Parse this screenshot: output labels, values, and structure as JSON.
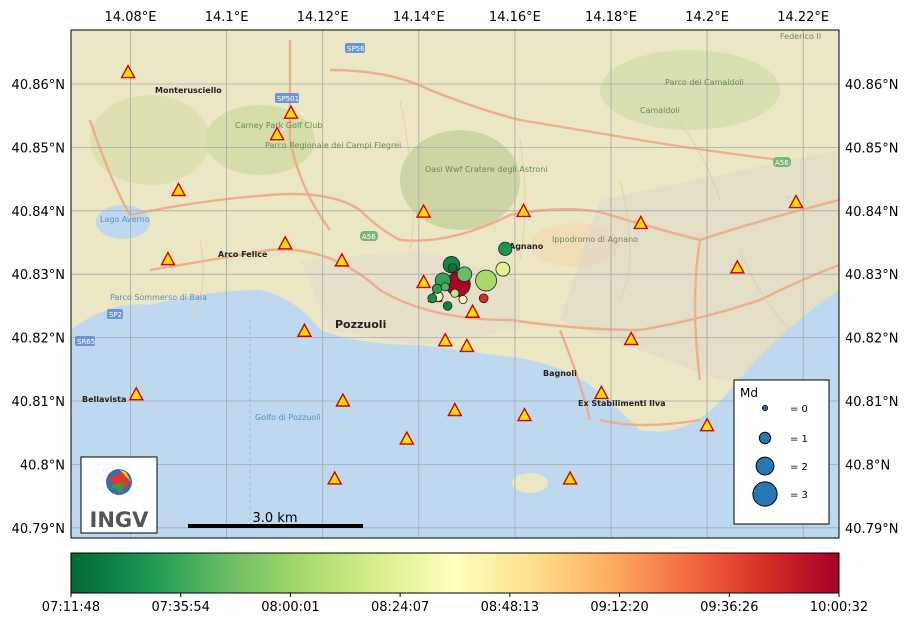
{
  "map": {
    "lon_ticks": [
      "14.08°E",
      "14.1°E",
      "14.12°E",
      "14.14°E",
      "14.16°E",
      "14.18°E",
      "14.2°E",
      "14.22°E"
    ],
    "lat_ticks": [
      "40.86°N",
      "40.85°N",
      "40.84°N",
      "40.83°N",
      "40.82°N",
      "40.81°N",
      "40.8°N",
      "40.79°N"
    ],
    "place_labels": {
      "monterusciello": "Monterusciello",
      "arco_felice": "Arco Felice",
      "pozzuoli": "Pozzuoli",
      "agnano": "Agnano",
      "bagnoli": "Bagnoli",
      "bellavista": "Bellavista",
      "lago_averno": "Lago Averno",
      "golfo": "Golfo di Pozzuoli",
      "carney": "Carney Park Golf Club",
      "campi_flegrei_park": "Parco Regionale dei Campi Flegrei",
      "astroni": "Oasi Wwf Cratere degli Astroni",
      "ippodromo": "Ippodromo di Agnano",
      "camaldoli": "Camaldoli",
      "parco_baia": "Parco Sommerso di Baia",
      "parco_camaldoli": "Parco dei Camaldoli",
      "stabilimenti": "Ex Stabilimenti Ilva",
      "sp56": "SP56",
      "sp501": "SP501",
      "sp2": "SP2",
      "sr65": "SR65",
      "a56": "A56",
      "a56b": "A56",
      "federico": "Federico II"
    },
    "scale_label": "3.0 km",
    "logo_text": "INGV"
  },
  "legend": {
    "title": "Md",
    "entries": [
      "= 0",
      "= 1",
      "= 2",
      "= 3"
    ],
    "magnitudes": [
      0,
      1,
      2,
      3
    ],
    "color": "#2878b5"
  },
  "colorbar": {
    "ticks": [
      "07:11:48",
      "07:35:54",
      "08:00:01",
      "08:24:07",
      "08:48:13",
      "09:12:20",
      "09:36:26",
      "10:00:32"
    ],
    "colormap": "RdYlGn_r",
    "stops": [
      "#006837",
      "#1a9850",
      "#66bd63",
      "#a6d96a",
      "#d9ef8b",
      "#ffffbf",
      "#fee08b",
      "#fdae61",
      "#f46d43",
      "#d73027",
      "#a50026"
    ]
  },
  "stations": [
    {
      "lon": 14.0795,
      "lat": 40.8618
    },
    {
      "lon": 14.1134,
      "lat": 40.8554
    },
    {
      "lon": 14.1105,
      "lat": 40.852
    },
    {
      "lon": 14.09,
      "lat": 40.8432
    },
    {
      "lon": 14.1122,
      "lat": 40.8348
    },
    {
      "lon": 14.0878,
      "lat": 40.8323
    },
    {
      "lon": 14.124,
      "lat": 40.8321
    },
    {
      "lon": 14.141,
      "lat": 40.8398
    },
    {
      "lon": 14.1618,
      "lat": 40.8399
    },
    {
      "lon": 14.1862,
      "lat": 40.838
    },
    {
      "lon": 14.2185,
      "lat": 40.8413
    },
    {
      "lon": 14.2063,
      "lat": 40.831
    },
    {
      "lon": 14.141,
      "lat": 40.8287
    },
    {
      "lon": 14.1434,
      "lat": 40.8265
    },
    {
      "lon": 14.1512,
      "lat": 40.824
    },
    {
      "lon": 14.1162,
      "lat": 40.821
    },
    {
      "lon": 14.1455,
      "lat": 40.8195
    },
    {
      "lon": 14.15,
      "lat": 40.8186
    },
    {
      "lon": 14.1842,
      "lat": 40.8197
    },
    {
      "lon": 14.0812,
      "lat": 40.811
    },
    {
      "lon": 14.1242,
      "lat": 40.81
    },
    {
      "lon": 14.1475,
      "lat": 40.8085
    },
    {
      "lon": 14.162,
      "lat": 40.8077
    },
    {
      "lon": 14.178,
      "lat": 40.8112
    },
    {
      "lon": 14.1375,
      "lat": 40.804
    },
    {
      "lon": 14.2,
      "lat": 40.8061
    },
    {
      "lon": 14.1715,
      "lat": 40.7977
    },
    {
      "lon": 14.1225,
      "lat": 40.7977
    }
  ],
  "events": [
    {
      "lon": 14.1482,
      "lat": 40.8284,
      "md": 3.0,
      "t": 0.99
    },
    {
      "lon": 14.1468,
      "lat": 40.8315,
      "md": 1.8,
      "t": 0.06
    },
    {
      "lon": 14.154,
      "lat": 40.829,
      "md": 2.5,
      "t": 0.3
    },
    {
      "lon": 14.145,
      "lat": 40.829,
      "md": 1.6,
      "t": 0.13
    },
    {
      "lon": 14.1575,
      "lat": 40.8308,
      "md": 1.4,
      "t": 0.42
    },
    {
      "lon": 14.158,
      "lat": 40.834,
      "md": 1.3,
      "t": 0.1
    },
    {
      "lon": 14.1495,
      "lat": 40.83,
      "md": 1.5,
      "t": 0.2
    },
    {
      "lon": 14.144,
      "lat": 40.8265,
      "md": 0.8,
      "t": 0.48
    },
    {
      "lon": 14.146,
      "lat": 40.825,
      "md": 0.6,
      "t": 0.05
    },
    {
      "lon": 14.1492,
      "lat": 40.826,
      "md": 0.5,
      "t": 0.52
    },
    {
      "lon": 14.1438,
      "lat": 40.8277,
      "md": 0.7,
      "t": 0.12
    },
    {
      "lon": 14.1428,
      "lat": 40.8262,
      "md": 0.6,
      "t": 0.08
    },
    {
      "lon": 14.147,
      "lat": 40.831,
      "md": 0.6,
      "t": 0.02
    },
    {
      "lon": 14.1535,
      "lat": 40.8262,
      "md": 0.6,
      "t": 0.91
    },
    {
      "lon": 14.1475,
      "lat": 40.827,
      "md": 0.5,
      "t": 0.35
    },
    {
      "lon": 14.1455,
      "lat": 40.828,
      "md": 0.5,
      "t": 0.17
    }
  ]
}
